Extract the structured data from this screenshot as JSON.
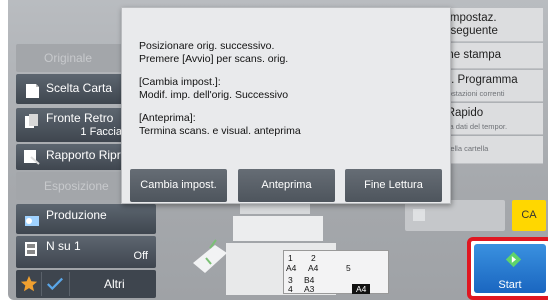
{
  "left_menu": {
    "originale": "Originale",
    "scelta_carta": "Scelta Carta",
    "fronte_retro": "Fronte Retro",
    "fronte_retro_value": "1 Faccia",
    "rapporto": "Rapporto Ripr.",
    "esposizione": "Esposizione",
    "produzione": "Produzione",
    "n_su_1": "N su 1",
    "n_su_1_value": "Off",
    "altri": "Altri"
  },
  "right_menu": {
    "item1_line1": "ca impostaz.",
    "item1_line2": "ale seguente",
    "item2": "come stampa",
    "item3_line1": "traz. Programma",
    "item3_sub": "i impostazioni correnti",
    "item4_line1": "ile Rapido",
    "item4_sub": "rchivia dati del tempor.",
    "item5_sub": "dati nella cartella"
  },
  "popup": {
    "line1": "Posizionare orig. successivo.",
    "line2": "Premere [Avvio] per scans. orig.",
    "line3": "[Cambia impost.]:",
    "line4": "Modif. imp. dell'orig. Successivo",
    "line5": "[Anteprima]:",
    "line6": "Termina scans. e visual. anteprima",
    "btn_cambia": "Cambia impost.",
    "btn_anteprima": "Anteprima",
    "btn_fine": "Fine Lettura"
  },
  "trays": [
    {
      "num": "1",
      "size": "A4"
    },
    {
      "num": "2",
      "size": "A4"
    },
    {
      "num": "3",
      "size": "B4"
    },
    {
      "num": "4",
      "size": "A3"
    },
    {
      "num": "5",
      "size": ""
    },
    {
      "num": "",
      "size": "A4"
    }
  ],
  "ca_label": "CA",
  "start_label": "Start",
  "colors": {
    "start_blue": "#2a7fd4",
    "start_border": "#e01721",
    "ca_yellow": "#ffd700",
    "button_dark": "#4e555d",
    "star_orange": "#f0a030"
  }
}
